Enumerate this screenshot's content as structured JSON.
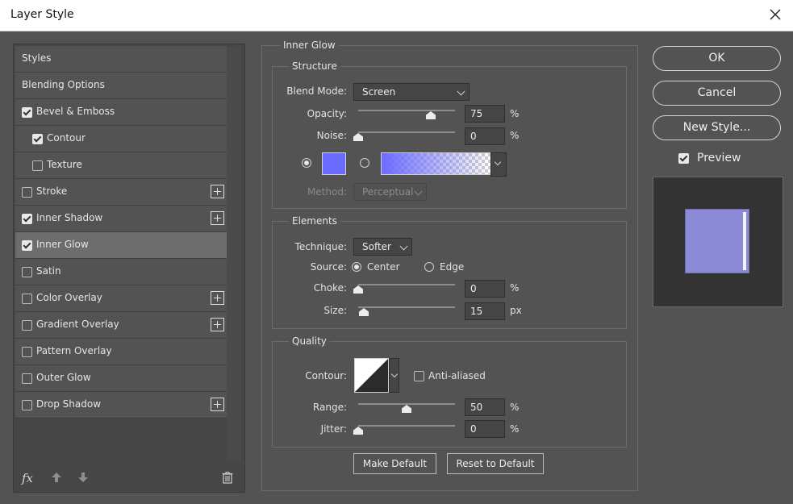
{
  "window": {
    "title": "Layer Style"
  },
  "styles_list": {
    "header": "Styles",
    "items": [
      {
        "label": "Blending Options",
        "checkbox": null,
        "indent": false,
        "plus": false,
        "selected": false
      },
      {
        "label": "Bevel & Emboss",
        "checkbox": true,
        "indent": false,
        "plus": false,
        "selected": false
      },
      {
        "label": "Contour",
        "checkbox": true,
        "indent": true,
        "plus": false,
        "selected": false
      },
      {
        "label": "Texture",
        "checkbox": false,
        "indent": true,
        "plus": false,
        "selected": false
      },
      {
        "label": "Stroke",
        "checkbox": false,
        "indent": false,
        "plus": true,
        "selected": false
      },
      {
        "label": "Inner Shadow",
        "checkbox": true,
        "indent": false,
        "plus": true,
        "selected": false
      },
      {
        "label": "Inner Glow",
        "checkbox": true,
        "indent": false,
        "plus": false,
        "selected": true
      },
      {
        "label": "Satin",
        "checkbox": false,
        "indent": false,
        "plus": false,
        "selected": false
      },
      {
        "label": "Color Overlay",
        "checkbox": false,
        "indent": false,
        "plus": true,
        "selected": false
      },
      {
        "label": "Gradient Overlay",
        "checkbox": false,
        "indent": false,
        "plus": true,
        "selected": false
      },
      {
        "label": "Pattern Overlay",
        "checkbox": false,
        "indent": false,
        "plus": false,
        "selected": false
      },
      {
        "label": "Outer Glow",
        "checkbox": false,
        "indent": false,
        "plus": false,
        "selected": false
      },
      {
        "label": "Drop Shadow",
        "checkbox": false,
        "indent": false,
        "plus": true,
        "selected": false
      }
    ],
    "footer": {
      "fx_label": "fx"
    }
  },
  "inner_glow": {
    "title": "Inner Glow",
    "structure": {
      "title": "Structure",
      "blend_mode_label": "Blend Mode:",
      "blend_mode_value": "Screen",
      "opacity_label": "Opacity:",
      "opacity_value": "75",
      "opacity_unit": "%",
      "noise_label": "Noise:",
      "noise_value": "0",
      "noise_unit": "%",
      "glow_color": "#6b6bff",
      "method_label": "Method:",
      "method_value": "Perceptual"
    },
    "elements": {
      "title": "Elements",
      "technique_label": "Technique:",
      "technique_value": "Softer",
      "source_label": "Source:",
      "source_center": "Center",
      "source_edge": "Edge",
      "choke_label": "Choke:",
      "choke_value": "0",
      "choke_unit": "%",
      "size_label": "Size:",
      "size_value": "15",
      "size_unit": "px"
    },
    "quality": {
      "title": "Quality",
      "contour_label": "Contour:",
      "anti_aliased_label": "Anti-aliased",
      "range_label": "Range:",
      "range_value": "50",
      "range_unit": "%",
      "jitter_label": "Jitter:",
      "jitter_value": "0",
      "jitter_unit": "%"
    },
    "make_default": "Make Default",
    "reset_default": "Reset to Default"
  },
  "actions": {
    "ok": "OK",
    "cancel": "Cancel",
    "new_style": "New Style...",
    "preview_label": "Preview"
  }
}
